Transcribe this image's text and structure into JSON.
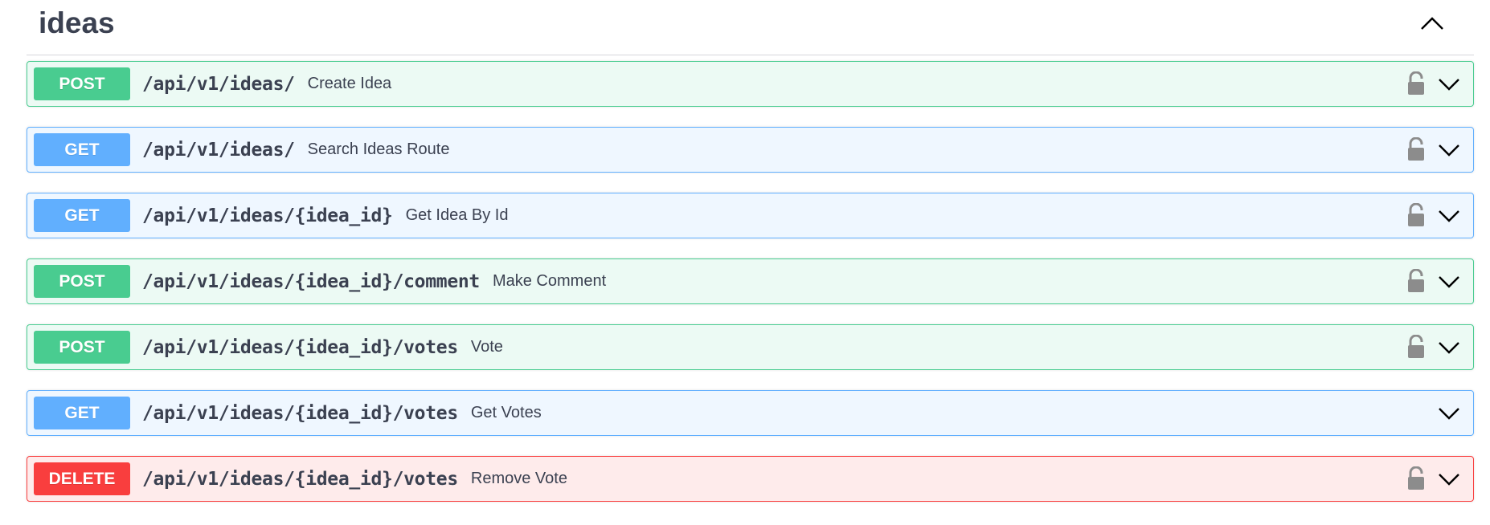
{
  "section": {
    "title": "ideas",
    "collapse_icon": "chevron-up-icon"
  },
  "operations": [
    {
      "method": "POST",
      "path": "/api/v1/ideas/",
      "summary": "Create Idea",
      "locked": true
    },
    {
      "method": "GET",
      "path": "/api/v1/ideas/",
      "summary": "Search Ideas Route",
      "locked": true
    },
    {
      "method": "GET",
      "path": "/api/v1/ideas/{idea_id}",
      "summary": "Get Idea By Id",
      "locked": true
    },
    {
      "method": "POST",
      "path": "/api/v1/ideas/{idea_id}/comment",
      "summary": "Make Comment",
      "locked": true
    },
    {
      "method": "POST",
      "path": "/api/v1/ideas/{idea_id}/votes",
      "summary": "Vote",
      "locked": true
    },
    {
      "method": "GET",
      "path": "/api/v1/ideas/{idea_id}/votes",
      "summary": "Get Votes",
      "locked": false
    },
    {
      "method": "DELETE",
      "path": "/api/v1/ideas/{idea_id}/votes",
      "summary": "Remove Vote",
      "locked": true
    }
  ],
  "colors": {
    "post": "#49cc90",
    "get": "#61affe",
    "delete": "#f93e3e",
    "lock": "#8c8c8c"
  }
}
